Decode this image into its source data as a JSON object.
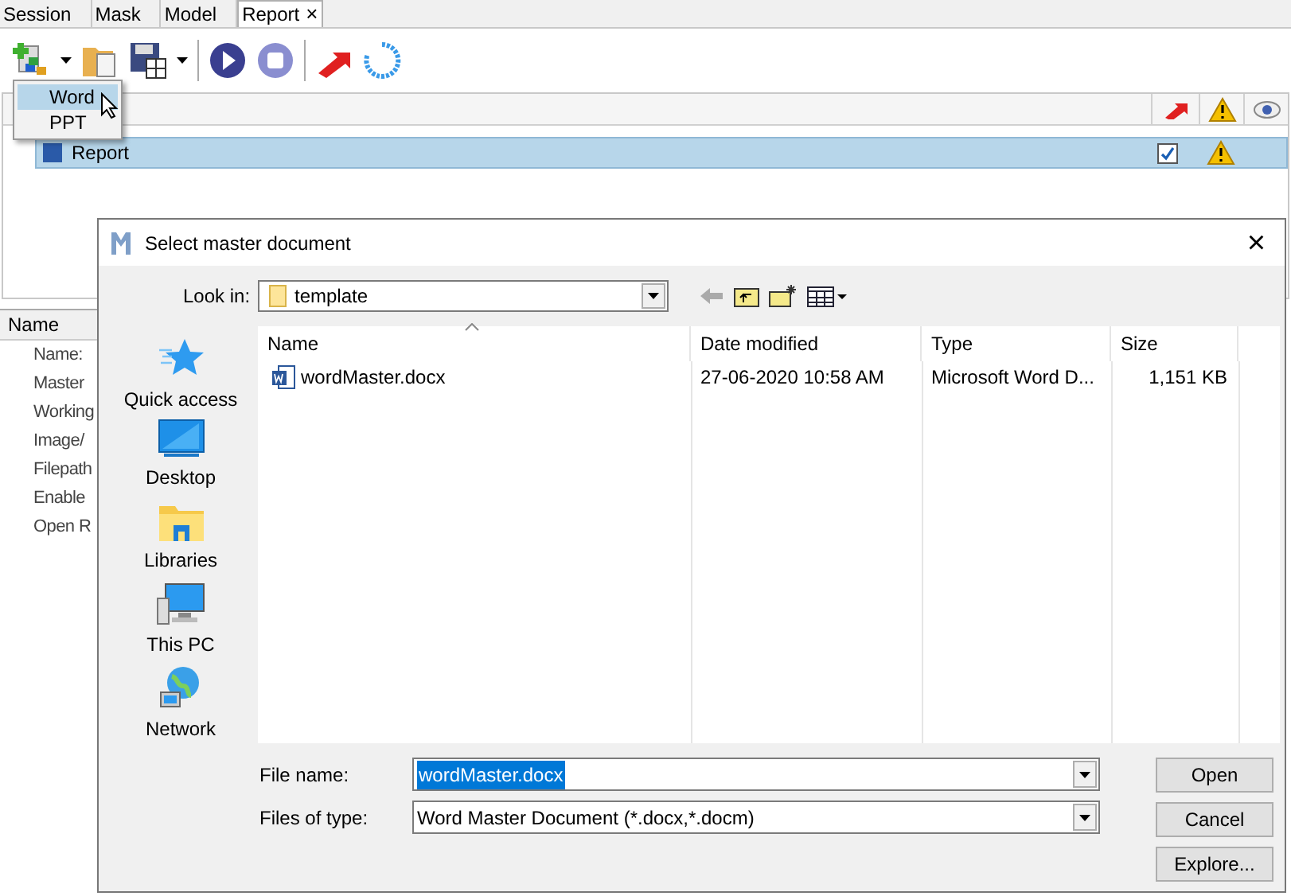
{
  "tabs": [
    {
      "label": "Session",
      "selected": false
    },
    {
      "label": "Mask",
      "selected": false
    },
    {
      "label": "Model",
      "selected": false
    },
    {
      "label": "Report",
      "selected": true,
      "close": "×"
    }
  ],
  "menu": {
    "items": [
      {
        "label": "Word",
        "selected": true
      },
      {
        "label": "PPT",
        "selected": false
      }
    ]
  },
  "tree": {
    "rows": [
      {
        "label": "Report",
        "selected": true,
        "checked": true
      }
    ]
  },
  "properties": {
    "header": "Name",
    "items": [
      "Name:",
      "Master",
      "Working",
      "Image/",
      "Filepath",
      "Enable",
      "Open R"
    ]
  },
  "dialog": {
    "title": "Select master document",
    "close": "×",
    "look_in": {
      "label": "Look in:",
      "value": "template"
    },
    "places": [
      {
        "label": "Quick access",
        "kind": "star"
      },
      {
        "label": "Desktop",
        "kind": "desktop"
      },
      {
        "label": "Libraries",
        "kind": "libraries"
      },
      {
        "label": "This PC",
        "kind": "pc"
      },
      {
        "label": "Network",
        "kind": "network"
      }
    ],
    "columns": [
      "Name",
      "Date modified",
      "Type",
      "Size"
    ],
    "files": [
      {
        "name": "wordMaster.docx",
        "date": "27-06-2020 10:58 AM",
        "type": "Microsoft Word D...",
        "size": "1,151 KB",
        "selected": false
      }
    ],
    "file_name": {
      "label": "File name:",
      "value": "wordMaster.docx"
    },
    "file_type": {
      "label": "Files of type:",
      "value": "Word Master Document (*.docx,*.docm)"
    },
    "buttons": [
      "Open",
      "Cancel",
      "Explore..."
    ]
  }
}
